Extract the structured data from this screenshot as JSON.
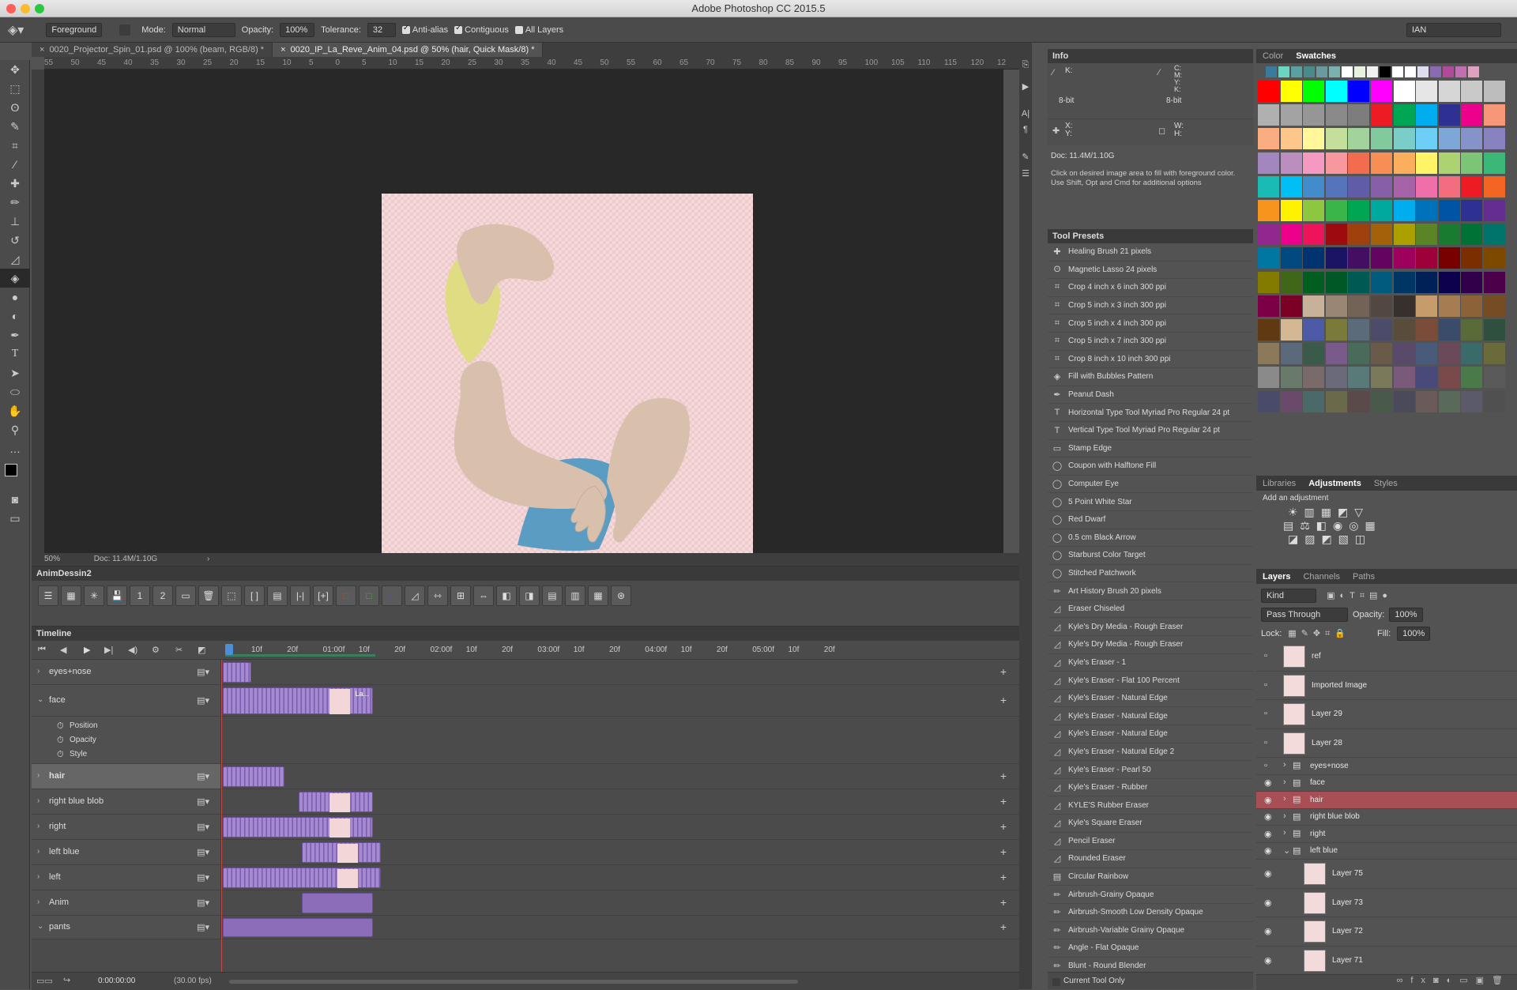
{
  "window": {
    "title": "Adobe Photoshop CC 2015.5"
  },
  "options_bar": {
    "fill_source": "Foreground",
    "mode_label": "Mode:",
    "mode_value": "Normal",
    "opacity_label": "Opacity:",
    "opacity_value": "100%",
    "tolerance_label": "Tolerance:",
    "tolerance_value": "32",
    "antialias": "Anti-alias",
    "contiguous": "Contiguous",
    "all_layers": "All Layers",
    "workspace": "IAN"
  },
  "doc_tabs": [
    "0020_Projector_Spin_01.psd @ 100% (beam, RGB/8) *",
    "0020_IP_La_Reve_Anim_04.psd @ 50% (hair, Quick Mask/8) *"
  ],
  "ruler": {
    "ticks": [
      "55",
      "50",
      "45",
      "40",
      "35",
      "30",
      "25",
      "20",
      "15",
      "10",
      "5",
      "0",
      "5",
      "10",
      "15",
      "20",
      "25",
      "30",
      "35",
      "40",
      "45",
      "50",
      "55",
      "60",
      "65",
      "70",
      "75",
      "80",
      "85",
      "90",
      "95",
      "100",
      "105",
      "110",
      "115",
      "120",
      "12"
    ]
  },
  "status": {
    "zoom": "50%",
    "doc": "Doc: 11.4M/1.10G"
  },
  "anim_panel": {
    "title": "AnimDessin2"
  },
  "timeline": {
    "title": "Timeline",
    "ruler_labels": [
      "10f",
      "20f",
      "01:00f",
      "10f",
      "20f",
      "02:00f",
      "10f",
      "20f",
      "03:00f",
      "10f",
      "20f",
      "04:00f",
      "10f",
      "20f",
      "05:00f",
      "10f",
      "20f"
    ],
    "tracks": [
      {
        "name": "eyes+nose",
        "expanded": false
      },
      {
        "name": "face",
        "expanded": true
      },
      {
        "name": "hair",
        "expanded": false
      },
      {
        "name": "right blue blob",
        "expanded": false
      },
      {
        "name": "right",
        "expanded": false
      },
      {
        "name": "left blue",
        "expanded": false
      },
      {
        "name": "left",
        "expanded": false
      },
      {
        "name": "Anim",
        "expanded": false
      },
      {
        "name": "pants",
        "expanded": true
      }
    ],
    "face_props": [
      "Position",
      "Opacity",
      "Style"
    ],
    "face_clip_label": "La...",
    "timecode": "0:00:00:00",
    "fps": "(30.00 fps)"
  },
  "info_panel": {
    "title": "Info",
    "k_label": "K:",
    "cmyk_labels": "C:\nM:\nY:\nK:",
    "bit_depth": "8-bit",
    "xy_labels": "X:\nY:",
    "wh_labels": "W:\nH:",
    "doc": "Doc: 11.4M/1.10G",
    "hint": "Click on desired image area to fill with foreground color.  Use Shift, Opt and Cmd for additional options"
  },
  "tool_presets": {
    "title": "Tool Presets",
    "items": [
      {
        "label": "Healing Brush 21 pixels",
        "icon": "bandage"
      },
      {
        "label": "Magnetic Lasso 24 pixels",
        "icon": "lasso"
      },
      {
        "label": "Crop 4 inch x 6 inch 300 ppi",
        "icon": "crop"
      },
      {
        "label": "Crop 5 inch x 3 inch 300 ppi",
        "icon": "crop"
      },
      {
        "label": "Crop 5 inch x 4 inch 300 ppi",
        "icon": "crop"
      },
      {
        "label": "Crop 5 inch x 7 inch 300 ppi",
        "icon": "crop"
      },
      {
        "label": "Crop 8 inch x 10 inch 300 ppi",
        "icon": "crop"
      },
      {
        "label": "Fill with Bubbles Pattern",
        "icon": "bucket"
      },
      {
        "label": "Peanut Dash",
        "icon": "pen"
      },
      {
        "label": "Horizontal Type Tool Myriad Pro Regular 24 pt",
        "icon": "type"
      },
      {
        "label": "Vertical Type Tool Myriad Pro Regular 24 pt",
        "icon": "type"
      },
      {
        "label": "Stamp Edge",
        "icon": "rect"
      },
      {
        "label": "Coupon with Halftone Fill",
        "icon": "circle"
      },
      {
        "label": "Computer Eye",
        "icon": "circle"
      },
      {
        "label": "5 Point White Star",
        "icon": "circle"
      },
      {
        "label": "Red Dwarf",
        "icon": "circle"
      },
      {
        "label": "0.5 cm Black Arrow",
        "icon": "circle"
      },
      {
        "label": "Starburst Color Target",
        "icon": "circle"
      },
      {
        "label": "Stitched Patchwork",
        "icon": "circle"
      },
      {
        "label": "Art History Brush 20 pixels",
        "icon": "brush"
      },
      {
        "label": "Eraser Chiseled",
        "icon": "eraser"
      },
      {
        "label": "Kyle's Dry Media - Rough Eraser",
        "icon": "eraser"
      },
      {
        "label": "Kyle's Dry Media - Rough Eraser",
        "icon": "eraser"
      },
      {
        "label": "Kyle's Eraser - 1",
        "icon": "eraser"
      },
      {
        "label": "Kyle's Eraser - Flat 100 Percent",
        "icon": "eraser"
      },
      {
        "label": "Kyle's Eraser - Natural Edge",
        "icon": "eraser"
      },
      {
        "label": "Kyle's Eraser - Natural Edge",
        "icon": "eraser"
      },
      {
        "label": "Kyle's Eraser - Natural Edge",
        "icon": "eraser"
      },
      {
        "label": "Kyle's Eraser - Natural Edge 2",
        "icon": "eraser"
      },
      {
        "label": "Kyle's Eraser - Pearl 50",
        "icon": "eraser"
      },
      {
        "label": "Kyle's Eraser - Rubber",
        "icon": "eraser"
      },
      {
        "label": "KYLE'S Rubber Eraser",
        "icon": "eraser"
      },
      {
        "label": "Kyle's Square Eraser",
        "icon": "eraser"
      },
      {
        "label": "Pencil Eraser",
        "icon": "eraser"
      },
      {
        "label": "Rounded Eraser",
        "icon": "eraser"
      },
      {
        "label": "Circular Rainbow",
        "icon": "gradient"
      },
      {
        "label": "Airbrush-Grainy Opaque",
        "icon": "brush"
      },
      {
        "label": "Airbrush-Smooth Low Density Opaque",
        "icon": "brush"
      },
      {
        "label": "Airbrush-Variable Grainy Opaque",
        "icon": "brush"
      },
      {
        "label": "Angle - Flat Opaque",
        "icon": "brush"
      },
      {
        "label": "Blunt - Round Blender",
        "icon": "brush"
      }
    ],
    "current_tool_only": "Current Tool Only"
  },
  "color_panel": {
    "tabs": [
      "Color",
      "Swatches"
    ]
  },
  "adjustments": {
    "tabs": [
      "Libraries",
      "Adjustments",
      "Styles"
    ],
    "add_label": "Add an adjustment"
  },
  "layers_panel": {
    "tabs": [
      "Layers",
      "Channels",
      "Paths"
    ],
    "kind": "Kind",
    "blend": "Pass Through",
    "opacity_label": "Opacity:",
    "opacity_value": "100%",
    "lock_label": "Lock:",
    "fill_label": "Fill:",
    "fill_value": "100%",
    "layers": [
      {
        "name": "ref",
        "type": "layer",
        "visible": false
      },
      {
        "name": "Imported Image",
        "type": "layer",
        "visible": false
      },
      {
        "name": "Layer 29",
        "type": "layer",
        "visible": false
      },
      {
        "name": "Layer 28",
        "type": "layer",
        "visible": false
      },
      {
        "name": "eyes+nose",
        "type": "group",
        "visible": false
      },
      {
        "name": "face",
        "type": "group",
        "visible": true
      },
      {
        "name": "hair",
        "type": "group",
        "visible": true,
        "selected": true
      },
      {
        "name": "right blue blob",
        "type": "group",
        "visible": true
      },
      {
        "name": "right",
        "type": "group",
        "visible": true
      },
      {
        "name": "left blue",
        "type": "group",
        "visible": true,
        "open": true
      },
      {
        "name": "Layer 75",
        "type": "child",
        "visible": true
      },
      {
        "name": "Layer 73",
        "type": "child",
        "visible": true
      },
      {
        "name": "Layer 72",
        "type": "child",
        "visible": true
      },
      {
        "name": "Layer 71",
        "type": "child",
        "visible": true
      }
    ]
  },
  "colors": {
    "accent_selected_layer": "#a84e55",
    "clip_purple": "#8c6dba",
    "canvas_pink": "#f4dbdb",
    "skin": "#d8c0ad",
    "hair_yellow": "#dfdc84",
    "blue": "#5b9cc2"
  }
}
